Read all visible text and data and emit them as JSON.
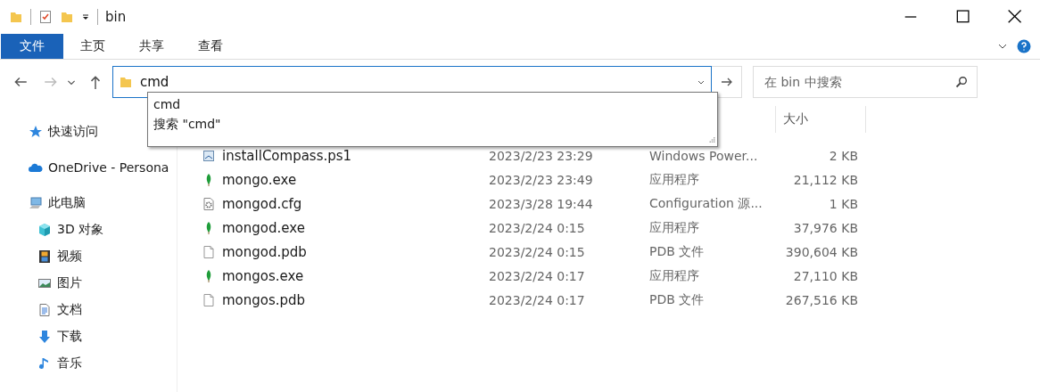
{
  "window": {
    "title": "bin"
  },
  "ribbon_tabs": [
    {
      "label": "文件",
      "selected": true
    },
    {
      "label": "主页",
      "selected": false
    },
    {
      "label": "共享",
      "selected": false
    },
    {
      "label": "查看",
      "selected": false
    }
  ],
  "address_bar": {
    "value": "cmd"
  },
  "autocomplete": [
    {
      "text": "cmd"
    },
    {
      "text": "搜索 \"cmd\""
    }
  ],
  "search": {
    "placeholder": "在 bin 中搜索"
  },
  "sidebar": {
    "items": [
      {
        "label": "快速访问",
        "kind": "quick"
      },
      {
        "label": "OneDrive - Persona",
        "kind": "cloud"
      },
      {
        "label": "此电脑",
        "kind": "pc",
        "children": [
          {
            "label": "3D 对象",
            "kind": "cube"
          },
          {
            "label": "视频",
            "kind": "video"
          },
          {
            "label": "图片",
            "kind": "pictures"
          },
          {
            "label": "文档",
            "kind": "docs"
          },
          {
            "label": "下载",
            "kind": "download"
          },
          {
            "label": "音乐",
            "kind": "music"
          }
        ]
      }
    ]
  },
  "file_list": {
    "size_header": "大小",
    "rows": [
      {
        "kind": "script",
        "name": "installCompass.ps1",
        "modified": "2023/2/23 23:29",
        "type": "Windows Power...",
        "size": "2 KB"
      },
      {
        "kind": "app",
        "name": "mongo.exe",
        "modified": "2023/2/23 23:49",
        "type": "应用程序",
        "size": "21,112 KB"
      },
      {
        "kind": "config",
        "name": "mongod.cfg",
        "modified": "2023/3/28 19:44",
        "type": "Configuration 源...",
        "size": "1 KB"
      },
      {
        "kind": "app",
        "name": "mongod.exe",
        "modified": "2023/2/24 0:15",
        "type": "应用程序",
        "size": "37,976 KB"
      },
      {
        "kind": "file",
        "name": "mongod.pdb",
        "modified": "2023/2/24 0:15",
        "type": "PDB 文件",
        "size": "390,604 KB"
      },
      {
        "kind": "app",
        "name": "mongos.exe",
        "modified": "2023/2/24 0:17",
        "type": "应用程序",
        "size": "27,110 KB"
      },
      {
        "kind": "file",
        "name": "mongos.pdb",
        "modified": "2023/2/24 0:17",
        "type": "PDB 文件",
        "size": "267,516 KB"
      }
    ]
  }
}
